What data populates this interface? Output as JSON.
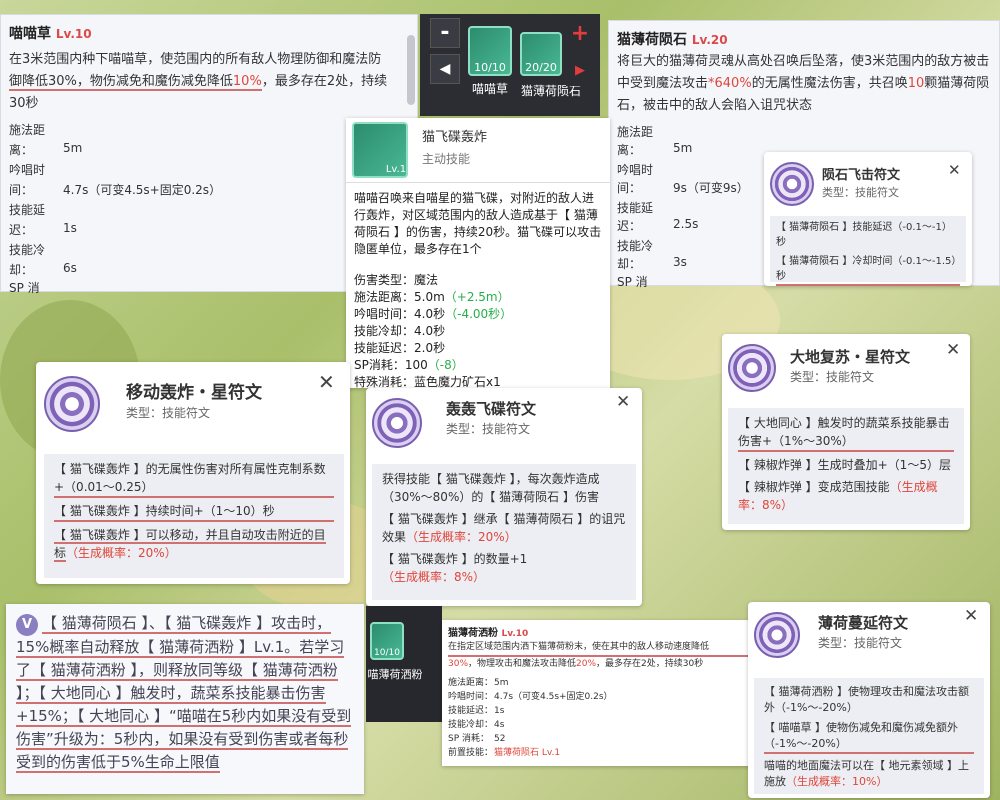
{
  "p1": {
    "title": "喵喵草",
    "lv": "Lv.10",
    "desc_a": "在3米范围内种下喵喵草，使范围内的所有敌人物理防御和魔法防",
    "desc_b1": "御降低30%，物伤减免和魔伤减免降低",
    "desc_b2": "10%",
    "desc_b3": "，最多存在2处，持续",
    "desc_c": "30秒",
    "k1a": "施法距",
    "k1b": "离：",
    "v1": "5m",
    "k2a": "吟唱时",
    "k2b": "间：",
    "v2": "4.7s（可变4.5s+固定0.2s）",
    "k3a": "技能延",
    "k3b": "迟：",
    "v3": "1s",
    "k4a": "技能冷",
    "k4b": "却：",
    "v4": "6s",
    "k5a": "SP 消"
  },
  "bar1": {
    "minus": "-",
    "plus": "+",
    "left": "◀",
    "right": "▶",
    "icon1_count": "10/10",
    "icon1_label": "喵喵草",
    "icon2_count": "20/20",
    "icon2_label": "猫薄荷陨石"
  },
  "p2": {
    "title": "猫薄荷陨石",
    "lv": "Lv.20",
    "desc1": "将巨大的猫薄荷灵魂从高处召唤后坠落，使3米范围内的敌方被击",
    "desc2a": "中受到魔法攻击",
    "desc2b": "*640%",
    "desc2c": "的无属性魔法伤害，共召唤",
    "desc2d": "10",
    "desc2e": "颗猫薄荷陨",
    "desc3": "石，被击中的敌人会陷入诅咒状态",
    "k1a": "施法距",
    "k1b": "离：",
    "v1": "5m",
    "k2a": "吟唱时",
    "k2b": "间：",
    "v2": "9s（可变9s）",
    "k3a": "技能延",
    "k3b": "迟：",
    "v3": "2.5s",
    "k4a": "技能冷",
    "k4b": "却：",
    "v4": "3s",
    "k5a": "SP 消"
  },
  "r_meteor": {
    "title": "陨石飞击符文",
    "type": "类型：技能符文",
    "l1": "【 猫薄荷陨石 】技能延迟（-0.1～-1）秒",
    "l2": "【 猫薄荷陨石 】冷却时间（-0.1～-1.5）秒"
  },
  "ufo": {
    "title": "猫飞碟轰炸",
    "sub": "主动技能",
    "lv": "Lv.1",
    "desc": "喵喵召唤来自喵星的猫飞碟，对附近的敌人进行轰炸，对区域范围内的敌人造成基于【 猫薄荷陨石 】的伤害，持续20秒。猫飞碟可以攻击隐匿单位，最多存在1个",
    "s1k": "伤害类型：",
    "s1v": "魔法",
    "s2k": "施法距离：",
    "s2v": "5.0m",
    "s2g": "（+2.5m）",
    "s3k": "吟唱时间：",
    "s3v": "4.0秒",
    "s3g": "（-4.00秒）",
    "s4k": "技能冷却：",
    "s4v": "4.0秒",
    "s5k": "技能延迟：",
    "s5v": "2.0秒",
    "s6k": "SP消耗：",
    "s6v": "100",
    "s6g": "（-8）",
    "s7k": "特殊消耗：",
    "s7v": "蓝色魔力矿石x1"
  },
  "r_move": {
    "title": "移动轰炸・星符文",
    "type": "类型：技能符文",
    "l1": "【 猫飞碟轰炸 】的无属性伤害对所有属性克制系数+（0.01～0.25）",
    "l2": "【 猫飞碟轰炸 】持续时间+（1～10）秒",
    "l3a": "【 猫飞碟轰炸 】可以移动，并且自动攻击附近的目标",
    "l3b": "（生成概率：20%）"
  },
  "r_ufo": {
    "title": "轰轰飞碟符文",
    "type": "类型：技能符文",
    "l1": "获得技能【 猫飞碟轰炸 】，每次轰炸造成（30%～80%）的【 猫薄荷陨石 】伤害",
    "l2a": "【 猫飞碟轰炸 】继承【 猫薄荷陨石 】的诅咒效果",
    "l2b": "（生成概率：20%）",
    "l3a": "【 猫飞碟轰炸 】的数量+1",
    "l3b": "（生成概率：8%）"
  },
  "r_earth": {
    "title": "大地复苏・星符文",
    "type": "类型：技能符文",
    "l1": "【 大地同心 】触发时的蔬菜系技能暴击伤害+（1%～30%）",
    "l2": "【 辣椒炸弹 】生成时叠加+（1～5）层",
    "l3a": "【 辣椒炸弹 】变成范围技能",
    "l3b": "（生成概率：8%）"
  },
  "bigtext": {
    "badge": "V",
    "text": "【 猫薄荷陨石 】、【 猫飞碟轰炸 】攻击时，15%概率自动释放【 猫薄荷洒粉 】Lv.1。若学习了【 猫薄荷洒粉 】，则释放同等级【 猫薄荷洒粉 】；【 大地同心 】触发时，蔬菜系技能暴击伤害+15%；【 大地同心 】“喵喵在5秒内如果没有受到伤害”升级为：5秒内，如果没有受到伤害或者每秒受到的伤害低于5%生命上限值"
  },
  "bar2": {
    "count": "10/10",
    "label": "喵薄荷洒粉"
  },
  "spray": {
    "title": "猫薄荷洒粉",
    "lv": "Lv.10",
    "d1": "在指定区域范围内洒下猫薄荷粉末，使在其中的敌人移动速度降低",
    "d2a": "30%",
    "d2b": "，物理攻击和魔法攻击降低",
    "d2c": "20%",
    "d2d": "，最多存在2处，持续30秒",
    "k1": "施法距离：",
    "v1": "5m",
    "k2": "吟唱时间：",
    "v2": "4.7s（可变4.5s+固定0.2s）",
    "k3": "技能延迟：",
    "v3": "1s",
    "k4": "技能冷却：",
    "v4": "4s",
    "k5": "SP 消耗：",
    "v5": "52",
    "k6": "前置技能：",
    "v6": "猫薄荷陨石 Lv.1"
  },
  "r_mint": {
    "title": "薄荷蔓延符文",
    "type": "类型：技能符文",
    "l1": "【 猫薄荷洒粉 】使物理攻击和魔法攻击额外（-1%～-20%）",
    "l2": "【 喵喵草 】使物伤减免和魔伤减免额外（-1%～-20%）",
    "l3a": "喵喵的地面魔法可以在【 地元素领域 】上施放",
    "l3b": "（生成概率：10%）"
  },
  "close": "✕"
}
